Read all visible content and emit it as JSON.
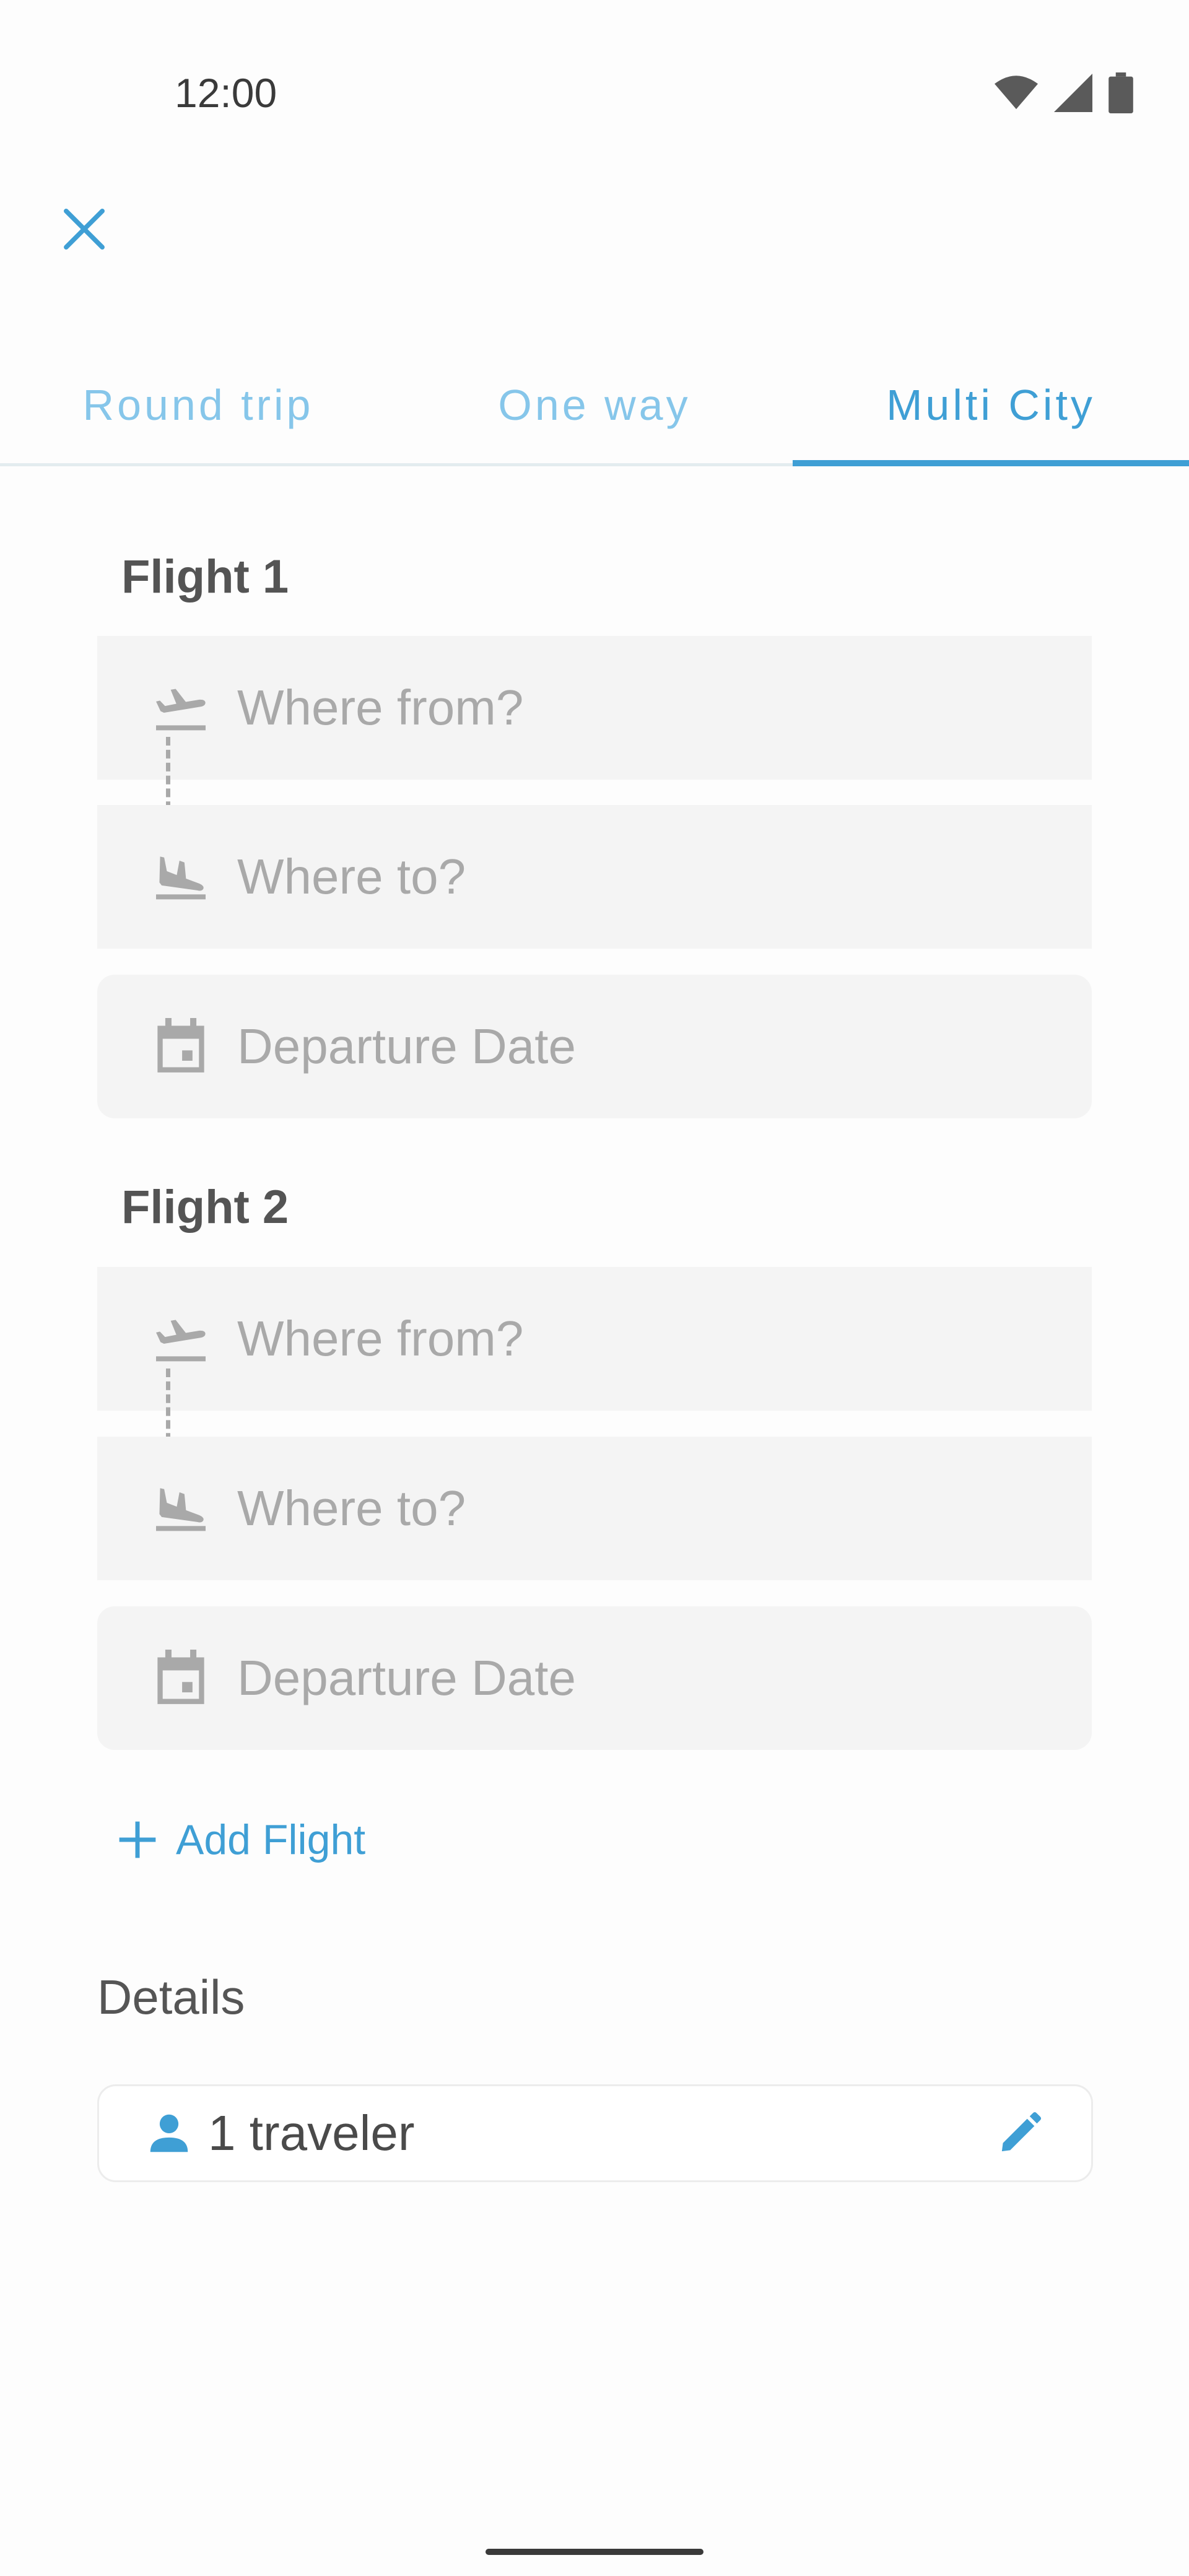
{
  "status_bar": {
    "time": "12:00"
  },
  "tabs": [
    {
      "label": "Round trip",
      "active": false
    },
    {
      "label": "One way",
      "active": false
    },
    {
      "label": "Multi City",
      "active": true
    }
  ],
  "flights": [
    {
      "title": "Flight 1",
      "from_placeholder": "Where from?",
      "to_placeholder": "Where to?",
      "date_placeholder": "Departure Date"
    },
    {
      "title": "Flight 2",
      "from_placeholder": "Where from?",
      "to_placeholder": "Where to?",
      "date_placeholder": "Departure Date"
    }
  ],
  "add_flight_label": "Add Flight",
  "details": {
    "title": "Details",
    "traveler_label": "1 traveler"
  },
  "icons": {
    "close": "close-icon",
    "takeoff": "flight-takeoff-icon",
    "landing": "flight-landing-icon",
    "calendar": "calendar-icon",
    "add": "plus-icon",
    "person": "person-icon",
    "edit": "pencil-icon"
  },
  "colors": {
    "accent": "#3f9fd5",
    "tab_inactive": "#86c6ea",
    "field_bg": "#f4f4f4",
    "placeholder": "#a9a9a9"
  }
}
